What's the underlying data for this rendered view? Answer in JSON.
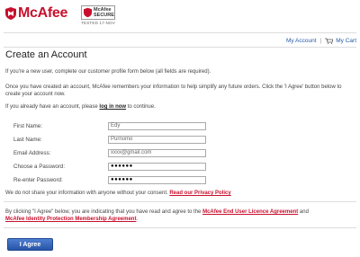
{
  "brand": {
    "logo_text": "McAfee",
    "secure_line1": "McAfee",
    "secure_line2": "SECURE",
    "secure_tested": "TESTED 17-NOV"
  },
  "nav": {
    "my_account": "My Account",
    "separator": "|",
    "cart": "My Cart"
  },
  "page_title": "Create an Account",
  "intro": "If you're a new user, complete our customer profile form below (all fields are required).",
  "info": "Once you have created an account, McAfee remembers your information to help simplify any future orders. Click the 'I Agree' button below to create your account now.",
  "login_prompt": {
    "before": "If you already have an account, please ",
    "link": "log in now",
    "after": " to continue."
  },
  "form": {
    "first_name": {
      "label": "First Name:",
      "value": "Edy"
    },
    "last_name": {
      "label": "Last Name:",
      "value": "Purnomo"
    },
    "email": {
      "label": "Email Address:",
      "value": "xxxx@gmail.com"
    },
    "password": {
      "label": "Choose a Password:",
      "value": "●●●●●●"
    },
    "reenter": {
      "label": "Re-enter Password:",
      "value": "●●●●●●"
    }
  },
  "privacy": {
    "text": "We do not share your information with anyone without your consent. ",
    "link": "Read our Privacy Policy"
  },
  "agreement": {
    "before": "By clicking \"I Agree\" below, you are indicating that you have read and agree to the ",
    "link1": "McAfee End User Licence Agreement",
    "middle": " and ",
    "link2": "McAfee Identity Protection Membership Agreement",
    "after": "."
  },
  "agree_button": "I Agree",
  "colors": {
    "brand_red": "#c8102e",
    "link_blue": "#2a5aa8",
    "button_blue": "#2754a8"
  }
}
